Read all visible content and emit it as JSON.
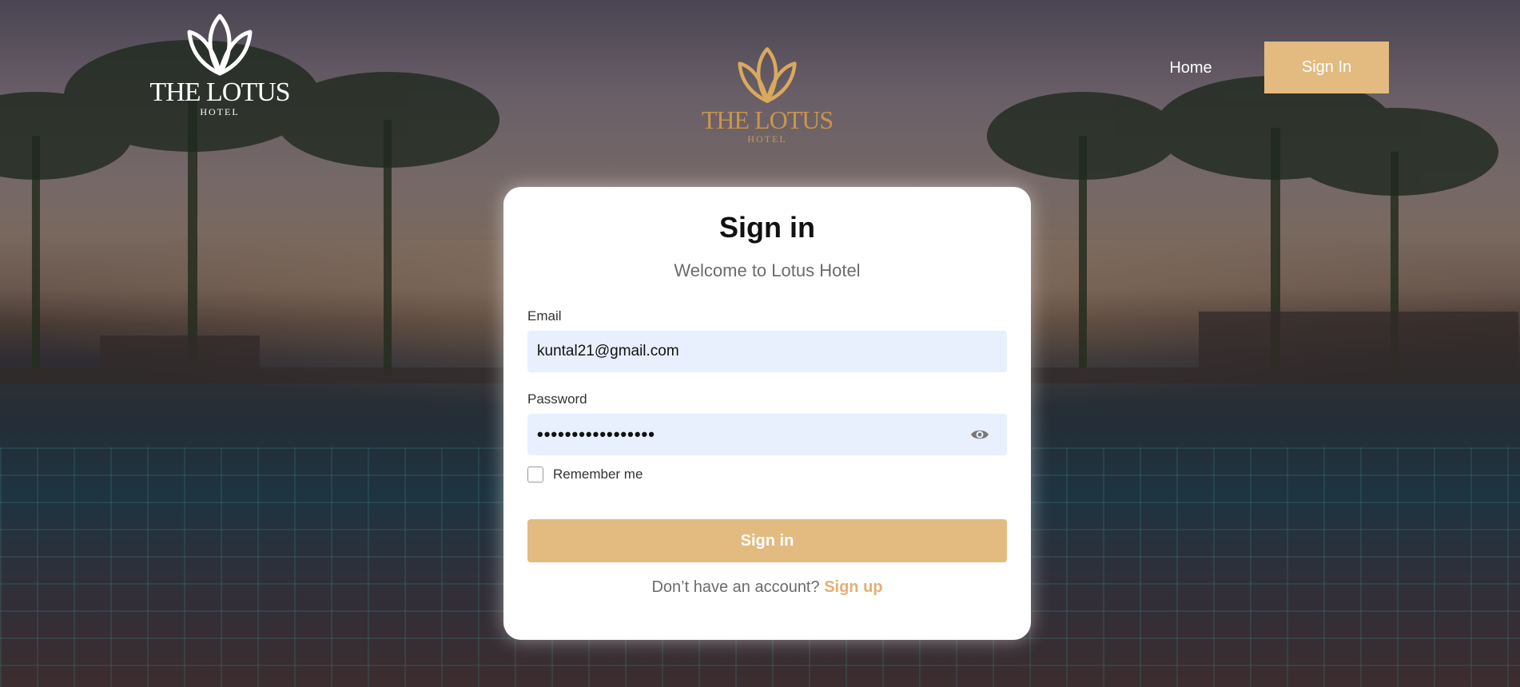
{
  "header": {
    "logo_left": {
      "name": "THE LOTUS",
      "sub": "HOTEL"
    },
    "logo_center": {
      "name": "THE LOTUS",
      "sub": "HOTEL"
    },
    "nav": {
      "home_label": "Home",
      "signin_label": "Sign In"
    }
  },
  "card": {
    "title": "Sign in",
    "subtitle": "Welcome to Lotus Hotel",
    "email": {
      "label": "Email",
      "value": "kuntal21@gmail.com"
    },
    "password": {
      "label": "Password",
      "masked_value": "•••••••••••••••••",
      "toggle_icon": "eye-icon"
    },
    "remember": {
      "label": "Remember me",
      "checked": false
    },
    "submit_label": "Sign in",
    "footer": {
      "prompt": "Don’t have an account?",
      "link_label": "Sign up"
    }
  },
  "colors": {
    "accent": "#e3bb80",
    "field_bg": "#e8effd",
    "link": "#e3b070",
    "logo_gold": "#c9954a"
  }
}
